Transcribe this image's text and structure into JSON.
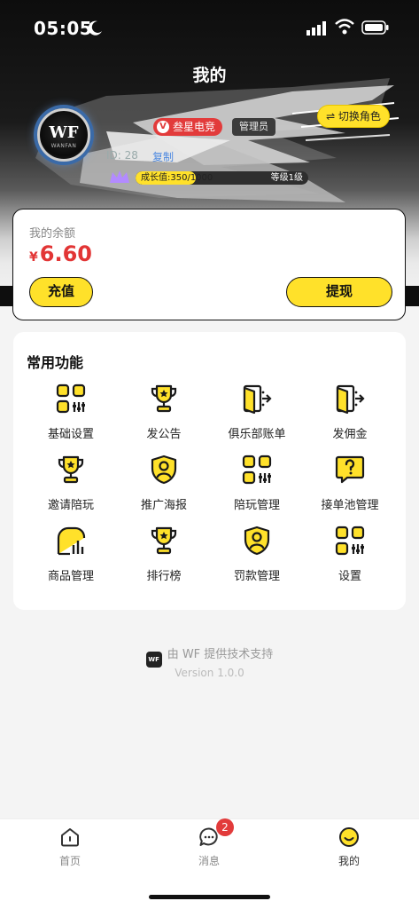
{
  "status_bar": {
    "time": "05:05"
  },
  "header": {
    "title": "我的",
    "club_name": "叁星电竞",
    "role": "管理员",
    "switch_role_label": "⇌ 切换角色",
    "user_id": "ID: 28",
    "copy_label": "复制",
    "growth": {
      "text": "成长值:350/1000",
      "current": 350,
      "max": 1000
    },
    "level": "等级1级",
    "logo_text": "WF",
    "logo_sub": "WANFAN"
  },
  "balance": {
    "label": "我的余额",
    "currency": "¥",
    "amount": "6.60",
    "recharge_label": "充值",
    "withdraw_label": "提现"
  },
  "functions": {
    "title": "常用功能",
    "items": [
      {
        "label": "基础设置",
        "icon": "grid-settings-icon"
      },
      {
        "label": "发公告",
        "icon": "trophy-icon"
      },
      {
        "label": "俱乐部账单",
        "icon": "door-exit-icon"
      },
      {
        "label": "发佣金",
        "icon": "door-exit-icon"
      },
      {
        "label": "邀请陪玩",
        "icon": "trophy-icon"
      },
      {
        "label": "推广海报",
        "icon": "user-shield-icon"
      },
      {
        "label": "陪玩管理",
        "icon": "grid-settings-icon"
      },
      {
        "label": "接单池管理",
        "icon": "question-chat-icon"
      },
      {
        "label": "商品管理",
        "icon": "chart-house-icon"
      },
      {
        "label": "排行榜",
        "icon": "trophy-icon"
      },
      {
        "label": "罚款管理",
        "icon": "user-shield-icon"
      },
      {
        "label": "设置",
        "icon": "grid-settings-icon"
      }
    ]
  },
  "footer": {
    "powered_by": "由 WF 提供技术支持",
    "version": "Version 1.0.0"
  },
  "tabs": [
    {
      "label": "首页",
      "icon": "home-icon"
    },
    {
      "label": "消息",
      "icon": "message-icon",
      "badge": "2"
    },
    {
      "label": "我的",
      "icon": "smile-icon",
      "active": true
    }
  ],
  "colors": {
    "accent": "#ffe12a",
    "amount": "#e23535",
    "badge": "#e23b3b"
  }
}
